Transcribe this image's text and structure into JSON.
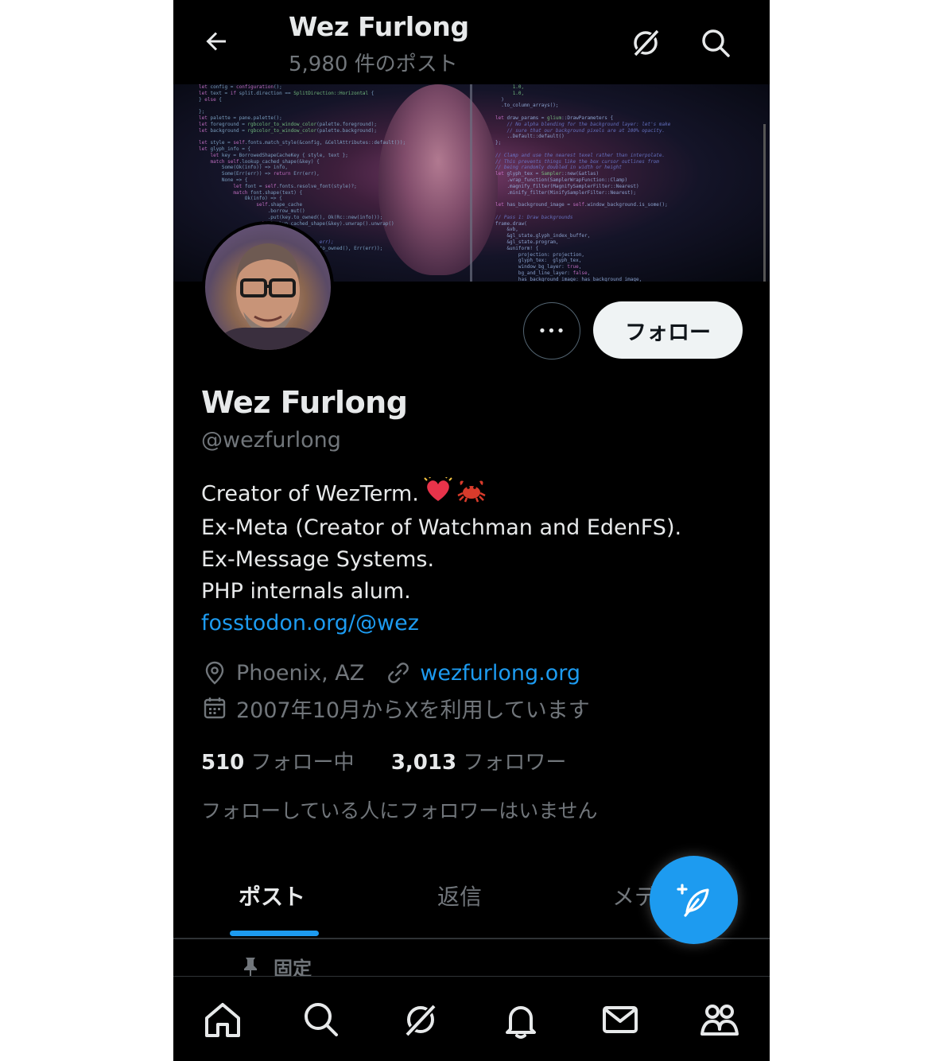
{
  "header": {
    "title": "Wez Furlong",
    "post_count": "5,980 件のポスト"
  },
  "profile": {
    "display_name": "Wez Furlong",
    "handle": "@wezfurlong",
    "more_label": "•••",
    "follow_label": "フォロー",
    "bio": {
      "line1": "Creator of WezTerm.",
      "line2": "Ex-Meta (Creator of Watchman and EdenFS).",
      "line3": "Ex-Message Systems.",
      "line4": "PHP internals alum.",
      "link": "fosstodon.org/@wez"
    },
    "location": "Phoenix, AZ",
    "website": "wezfurlong.org",
    "joined": "2007年10月からXを利用しています",
    "following_count": "510",
    "following_label": "フォロー中",
    "followers_count": "3,013",
    "followers_label": "フォロワー",
    "followers_note": "フォローしている人にフォロワーはいません"
  },
  "tabs": [
    {
      "label": "ポスト",
      "active": true
    },
    {
      "label": "返信",
      "active": false
    },
    {
      "label": "メデ",
      "active": false
    }
  ],
  "pinned_label": "固定",
  "colors": {
    "accent": "#1d9bf0",
    "background": "#000000",
    "text_primary": "#e7e9ea",
    "text_secondary": "#71767b"
  },
  "icons": {
    "back": "arrow-left-icon",
    "grok": "grok-icon",
    "search": "search-icon",
    "location": "location-pin-icon",
    "link": "link-icon",
    "calendar": "calendar-icon",
    "pin": "pin-icon",
    "compose": "compose-feather-icon",
    "nav": [
      "home-icon",
      "search-icon",
      "grok-icon",
      "notifications-bell-icon",
      "messages-envelope-icon",
      "communities-icon"
    ]
  }
}
